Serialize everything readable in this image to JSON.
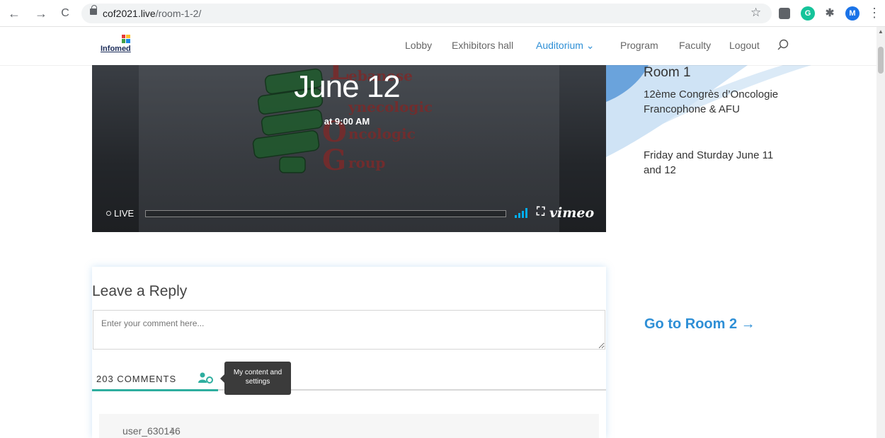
{
  "browser": {
    "url_domain": "cof2021.live",
    "url_path": "/room-1-2/",
    "profile_initial": "M",
    "back_icon": "←",
    "forward_icon": "→",
    "reload_icon": "C",
    "star_icon": "☆",
    "menu_icon": "⋮"
  },
  "header": {
    "logo_text": "Infomed",
    "nav": [
      {
        "label": "Lobby"
      },
      {
        "label": "Exhibitors hall"
      },
      {
        "label": "Auditorium ⌄",
        "active": true
      },
      {
        "label": "Program"
      },
      {
        "label": "Faculty"
      },
      {
        "label": "Logout"
      }
    ]
  },
  "video": {
    "date": "June 12",
    "time": "at 9:00 AM",
    "live_label": "LIVE",
    "brand": "vimeo",
    "logo_letters": [
      "ebanese",
      "ynecologic",
      "ncologic",
      "roup"
    ]
  },
  "sidebar": {
    "room_title": "Room 1",
    "room_description": "12ème Congrès d’Oncologie Francophone & AFU",
    "room_dates": "Friday and Sturday June 11 and 12",
    "go_room": "Go to Room 2 →"
  },
  "comments": {
    "title": "Leave a Reply",
    "placeholder": "Enter your comment here...",
    "count_label": "203 COMMENTS",
    "tooltip": "My content and settings",
    "first_user": "user_630146"
  },
  "colors": {
    "accent": "#2e8fd6",
    "tab_active": "#2eae9f"
  }
}
